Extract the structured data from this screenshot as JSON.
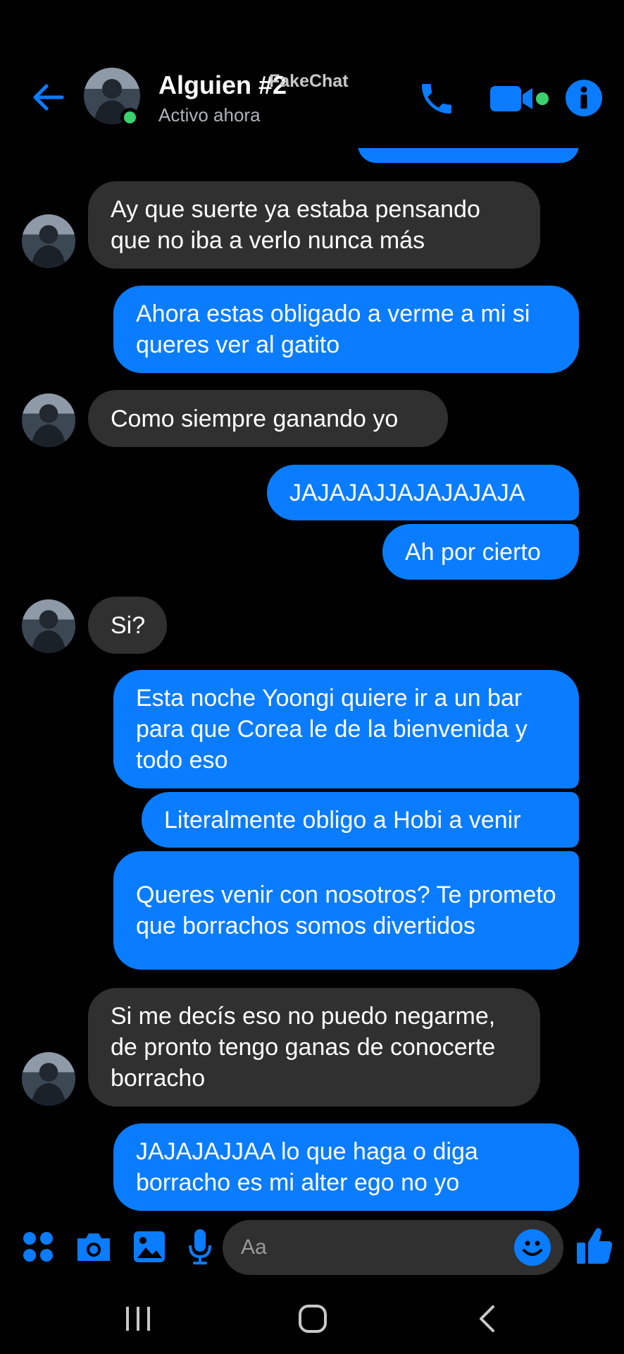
{
  "header": {
    "contact_name": "Alguien #2",
    "status": "Activo ahora",
    "watermark": "FakeChat"
  },
  "colors": {
    "accent": "#0a7cff",
    "incoming_bubble": "#303030",
    "background": "#000000",
    "online": "#3bd16f"
  },
  "icons": {
    "back": "arrow-left-icon",
    "call": "phone-icon",
    "video": "video-camera-icon",
    "info": "info-icon",
    "apps": "four-dots-icon",
    "camera": "camera-icon",
    "gallery": "image-icon",
    "mic": "microphone-icon",
    "emoji": "smiley-icon",
    "like": "thumbs-up-icon"
  },
  "messages": [
    {
      "from": "them",
      "text": "Ay que suerte ya estaba pensando que no iba a verlo nunca más"
    },
    {
      "from": "me",
      "text": "Ahora estas obligado a verme a mi si queres ver al gatito"
    },
    {
      "from": "them",
      "text": "Como siempre ganando yo"
    },
    {
      "from": "me",
      "text": "JAJAJAJJAJAJAJAJA"
    },
    {
      "from": "me",
      "text": "Ah por cierto"
    },
    {
      "from": "them",
      "text": "Si?"
    },
    {
      "from": "me",
      "text": "Esta noche Yoongi quiere ir a un bar para que Corea le de la bienvenida y todo eso"
    },
    {
      "from": "me",
      "text": "Literalmente obligo a Hobi a venir"
    },
    {
      "from": "me",
      "text": "Queres venir con nosotros? Te prometo que borrachos somos divertidos"
    },
    {
      "from": "them",
      "text": "Si me decís eso no puedo negarme, de pronto tengo ganas de conocerte borracho"
    },
    {
      "from": "me",
      "text": "JAJAJAJJAA lo que haga o diga borracho es mi alter ego no yo"
    }
  ],
  "composer": {
    "placeholder": "Aa"
  }
}
